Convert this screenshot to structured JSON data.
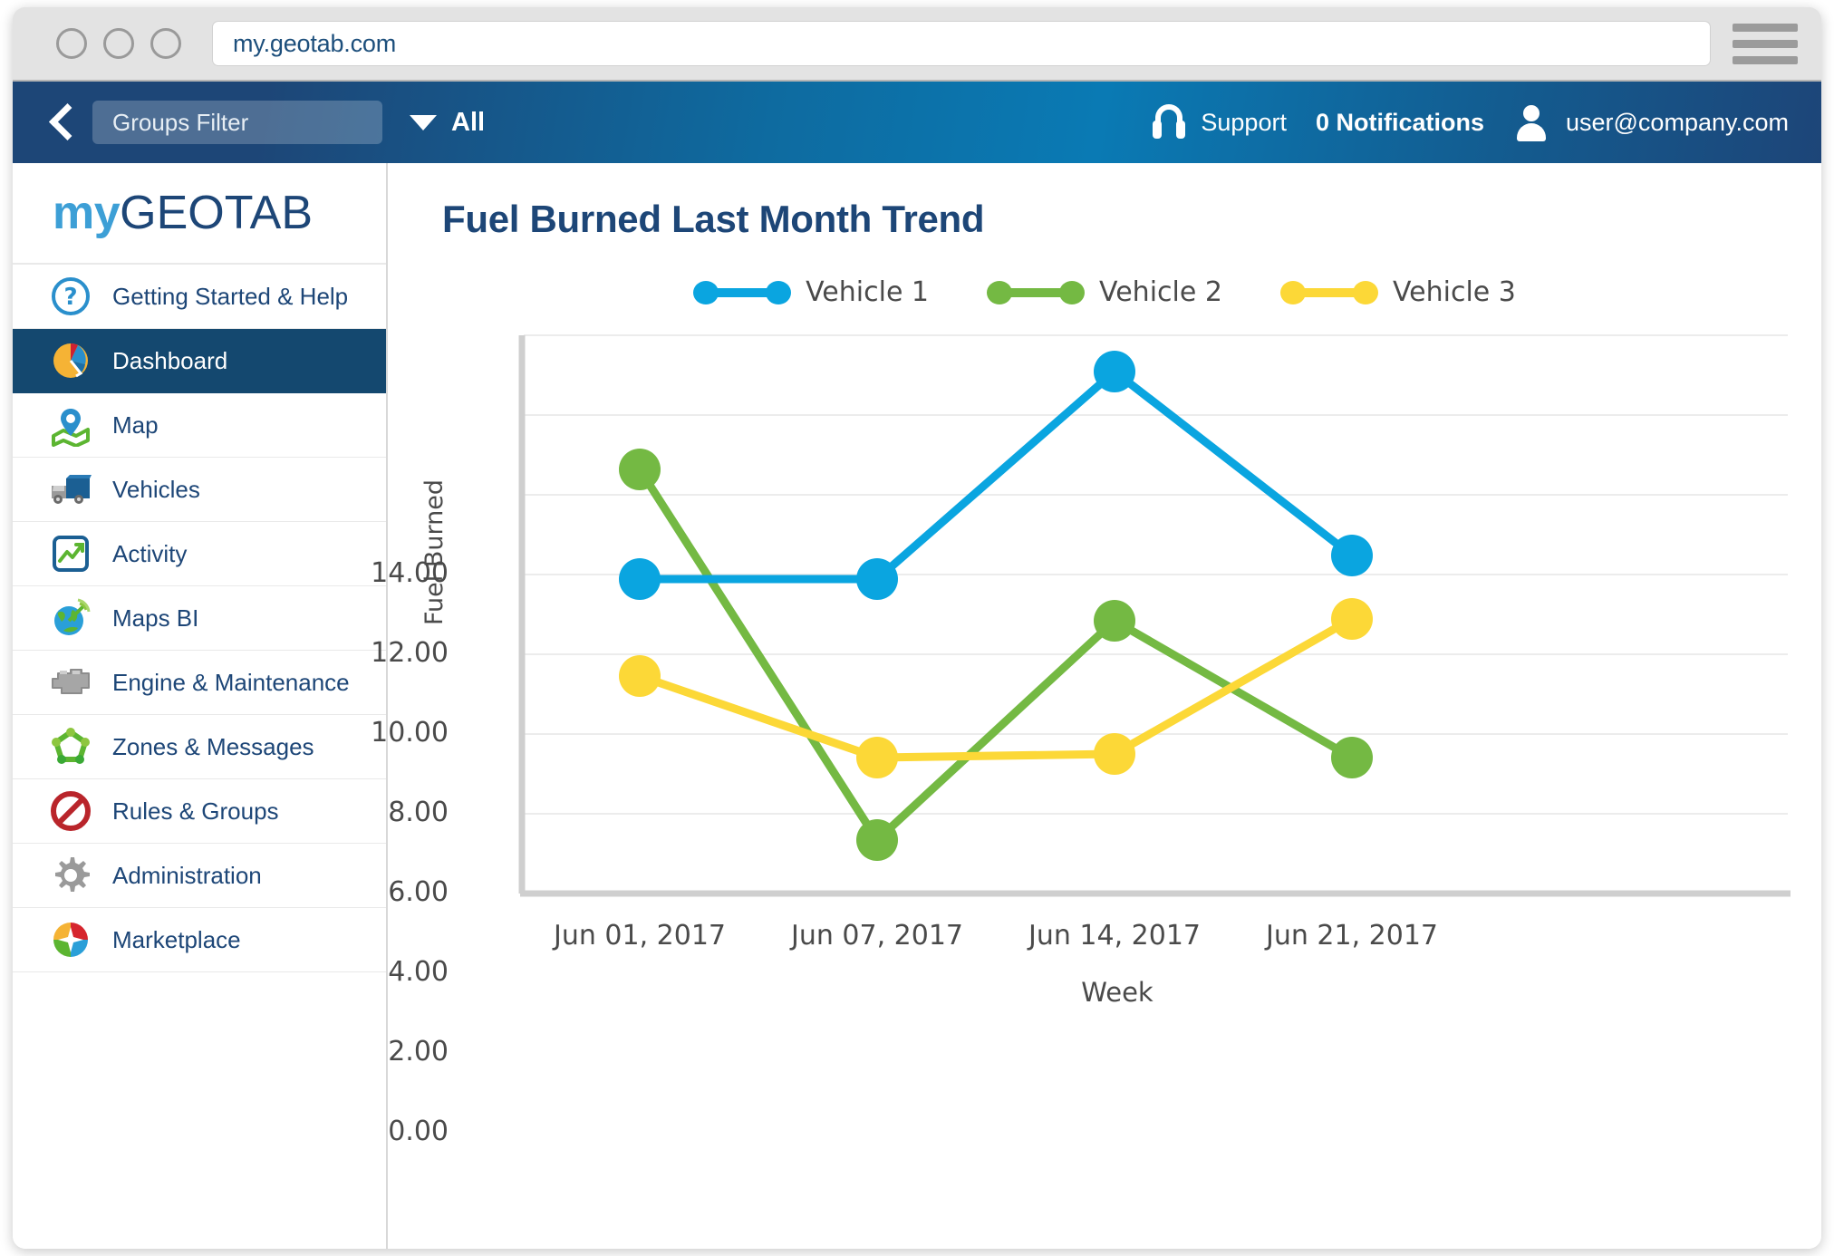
{
  "browser": {
    "url": "my.geotab.com",
    "traffic_lights": [
      "close",
      "minimize",
      "maximize"
    ],
    "menu_icon": "hamburger-icon"
  },
  "toolbar": {
    "back_icon": "back-chevron-icon",
    "groups_filter_label": "Groups Filter",
    "dropdown_icon": "caret-down-icon",
    "scope_label": "All",
    "support_icon": "headset-icon",
    "support_label": "Support",
    "notifications_label": "0 Notifications",
    "user_icon": "person-icon",
    "user_email": "user@company.com"
  },
  "sidebar": {
    "logo_my": "my",
    "logo_geotab": "GEOTAB",
    "items": [
      {
        "label": "Getting Started & Help",
        "icon": "question-mark-icon",
        "active": false
      },
      {
        "label": "Dashboard",
        "icon": "pie-chart-icon",
        "active": true
      },
      {
        "label": "Map",
        "icon": "map-pin-icon",
        "active": false
      },
      {
        "label": "Vehicles",
        "icon": "truck-icon",
        "active": false
      },
      {
        "label": "Activity",
        "icon": "trend-chart-icon",
        "active": false
      },
      {
        "label": "Maps BI",
        "icon": "globe-signal-icon",
        "active": false
      },
      {
        "label": "Engine & Maintenance",
        "icon": "engine-icon",
        "active": false
      },
      {
        "label": "Zones & Messages",
        "icon": "zones-network-icon",
        "active": false
      },
      {
        "label": "Rules & Groups",
        "icon": "no-entry-icon",
        "active": false
      },
      {
        "label": "Administration",
        "icon": "gear-icon",
        "active": false
      },
      {
        "label": "Marketplace",
        "icon": "marketplace-compass-icon",
        "active": false
      }
    ]
  },
  "chart_data": {
    "type": "line",
    "title": "Fuel Burned Last Month Trend",
    "xlabel": "Week",
    "ylabel": "Fuel Burned",
    "categories": [
      "Jun 01, 2017",
      "Jun 07, 2017",
      "Jun 14, 2017",
      "Jun 21, 2017"
    ],
    "ytick_labels": [
      "14.00",
      "12.00",
      "10.00",
      "8.00",
      "6.00",
      "4.00",
      "2.00",
      "0.00"
    ],
    "ytick_values": [
      14,
      12,
      10,
      8,
      6,
      4,
      2,
      0
    ],
    "ylim": [
      0,
      14
    ],
    "grid": true,
    "legend_position": "top-center",
    "series": [
      {
        "name": "Vehicle 1",
        "color": "#0aa5e0",
        "values": [
          7.9,
          7.9,
          13.1,
          8.5
        ]
      },
      {
        "name": "Vehicle 2",
        "color": "#74b943",
        "values": [
          10.65,
          1.35,
          6.85,
          3.4
        ]
      },
      {
        "name": "Vehicle 3",
        "color": "#fcd837",
        "values": [
          5.45,
          3.4,
          3.5,
          6.9
        ]
      }
    ]
  },
  "colors": {
    "brand_dark_blue": "#1d4677",
    "brand_light_blue": "#3d9fd6",
    "sidebar_active": "#14486f",
    "series_1": "#0aa5e0",
    "series_2": "#74b943",
    "series_3": "#fcd837",
    "axis_text": "#4a4a4a"
  }
}
